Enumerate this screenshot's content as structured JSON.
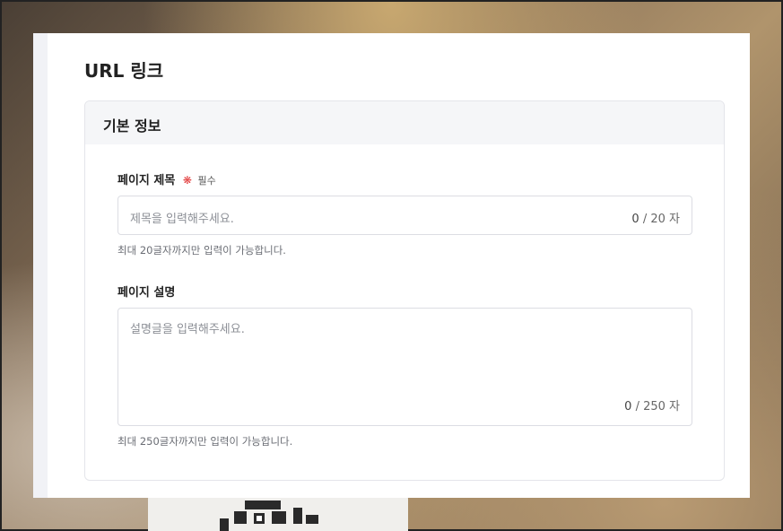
{
  "page": {
    "title": "URL 링크"
  },
  "section": {
    "title": "기본 정보"
  },
  "fields": {
    "title": {
      "label": "페이지 제목",
      "required_mark": "❋",
      "required_text": "필수",
      "placeholder": "제목을 입력해주세요.",
      "count": "0",
      "max": "/ 20 자",
      "hint": "최대 20글자까지만 입력이 가능합니다."
    },
    "description": {
      "label": "페이지 설명",
      "placeholder": "설명글을 입력해주세요.",
      "count": "0",
      "max": "/ 250 자",
      "hint": "최대 250글자까지만 입력이 가능합니다."
    }
  },
  "colors": {
    "required": "#e23a3a",
    "section_header_bg": "#f5f6f8",
    "border": "#dcdde3"
  }
}
